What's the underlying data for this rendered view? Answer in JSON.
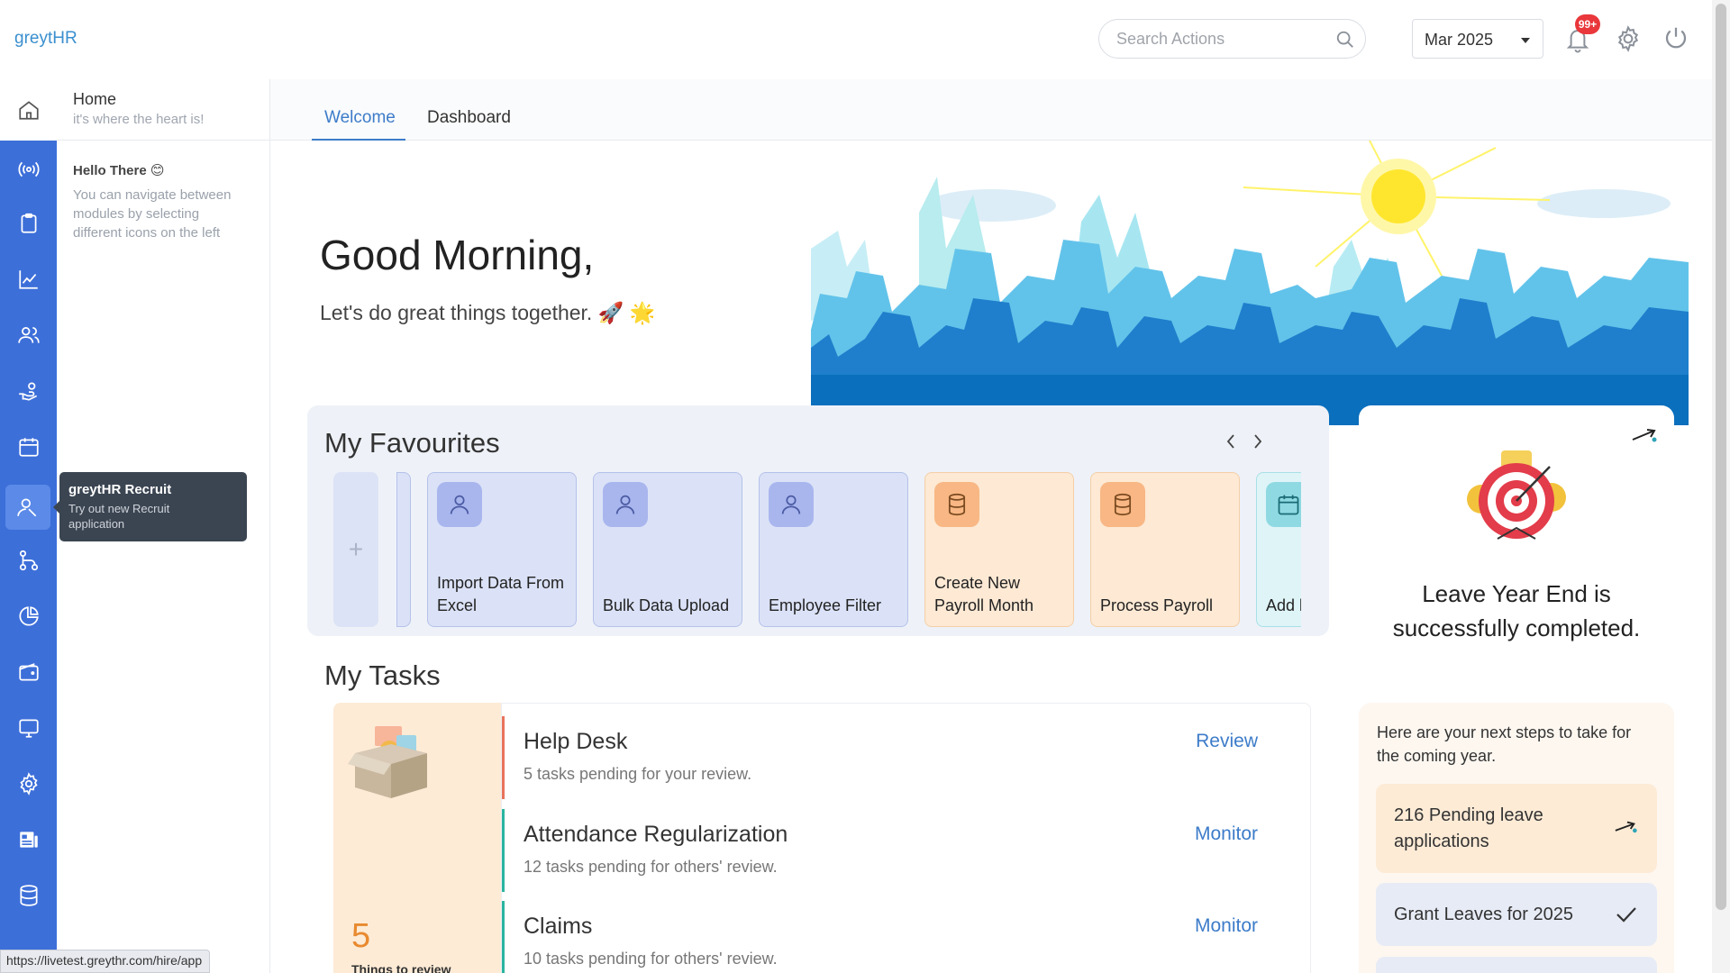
{
  "app": {
    "logo": "greytHR"
  },
  "header": {
    "search_placeholder": "Search Actions",
    "month": "Mar 2025",
    "notification_count": "99+"
  },
  "sidepanel": {
    "title": "Home",
    "subtitle": "it's where the heart is!",
    "hello": "Hello There 😊",
    "text": "You can navigate between modules by selecting different icons on the left"
  },
  "tooltip": {
    "title": "greytHR Recruit",
    "desc": "Try out new Recruit application"
  },
  "tabs": [
    {
      "label": "Welcome",
      "active": true
    },
    {
      "label": "Dashboard",
      "active": false
    }
  ],
  "hero": {
    "title": "Good Morning,",
    "subtitle": "Let's do great things together. 🚀 🌟"
  },
  "favourites": {
    "title": "My Favourites",
    "add_label": "+",
    "items": [
      {
        "label": "Import Data From Excel",
        "icon": "user-icon",
        "tone": "blue"
      },
      {
        "label": "Bulk Data Upload",
        "icon": "user-icon",
        "tone": "blue"
      },
      {
        "label": "Employee Filter",
        "icon": "user-icon",
        "tone": "blue"
      },
      {
        "label": "Create New Payroll Month",
        "icon": "database-icon",
        "tone": "orange"
      },
      {
        "label": "Process Payroll",
        "icon": "database-icon",
        "tone": "orange"
      },
      {
        "label": "Add l",
        "icon": "calendar-icon",
        "tone": "teal"
      }
    ]
  },
  "tasks": {
    "title": "My Tasks",
    "count": "5",
    "count_label": "Things to review",
    "items": [
      {
        "name": "Help Desk",
        "desc": "5 tasks pending for your review.",
        "action": "Review",
        "color": "#e8735a"
      },
      {
        "name": "Attendance Regularization",
        "desc": "12 tasks pending for others' review.",
        "action": "Monitor",
        "color": "#2bb5a0"
      },
      {
        "name": "Claims",
        "desc": "10 tasks pending for others' review.",
        "action": "Monitor",
        "color": "#2bb5a0"
      }
    ]
  },
  "leave": {
    "title": "Leave Year End is successfully completed.",
    "steps_intro": "Here are your next steps to take for the coming year.",
    "steps": [
      {
        "label": "216 Pending leave applications",
        "icon": "arrow-icon"
      },
      {
        "label": "Grant Leaves for 2025",
        "icon": "check-icon"
      }
    ]
  },
  "status_url": "https://livetest.greythr.com/hire/app",
  "colors": {
    "rail": "#3d6fd9",
    "accent": "#3d7cc9",
    "badge": "#e9373b"
  }
}
